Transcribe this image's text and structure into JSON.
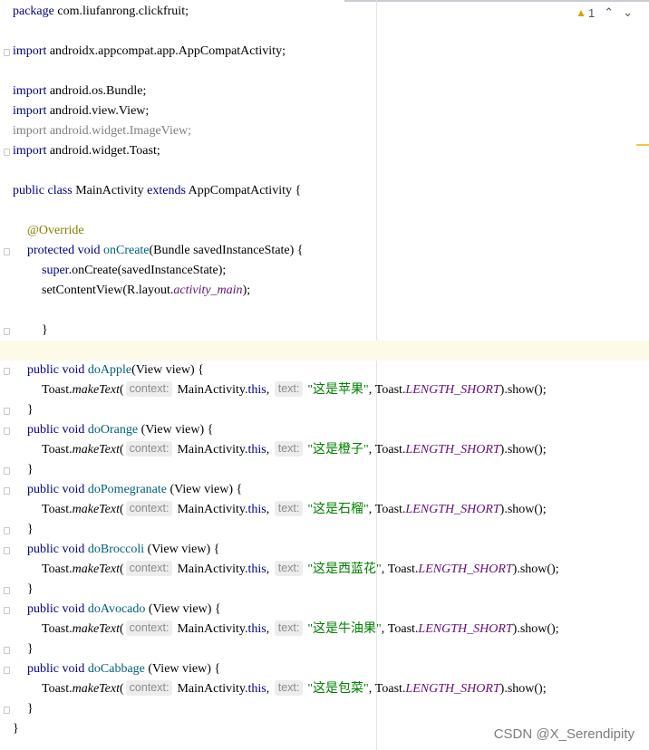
{
  "status": {
    "warning_icon": "warning-triangle-icon",
    "warning_count": "1",
    "up_arrow": "⌃",
    "down_arrow": "⌄"
  },
  "code": {
    "l1": {
      "kw": "package",
      "rest": " com.liufanrong.clickfruit;"
    },
    "l3": {
      "kw": "import",
      "rest": " androidx.appcompat.app.AppCompatActivity;"
    },
    "l5": {
      "kw": "import",
      "rest": " android.os.Bundle;"
    },
    "l6": {
      "kw": "import",
      "rest": " android.view.View;"
    },
    "l7": {
      "text": "import android.widget.ImageView;"
    },
    "l8": {
      "kw": "import",
      "rest": " android.widget.Toast;"
    },
    "l10": {
      "kw1": "public class",
      "name": " MainActivity ",
      "kw2": "extends",
      "rest": " AppCompatActivity {"
    },
    "l12": {
      "ann": "@Override"
    },
    "l13": {
      "kw": "protected void",
      "fn": " onCreate",
      "rest": "(Bundle savedInstanceState) {"
    },
    "l14": {
      "kw": "super",
      "rest": ".onCreate(savedInstanceState);"
    },
    "l15": {
      "pre": "setContentView(R.layout.",
      "ital": "activity_main",
      "post": ");"
    },
    "l17": {
      "text": "}"
    },
    "methods": [
      {
        "sig_kw": "public void",
        "name": " doApple",
        "params": "(View view) {",
        "string": "\"这是苹果\""
      },
      {
        "sig_kw": "public void",
        "name": " doOrange",
        "params": " (View view) {",
        "string": "\"这是橙子\""
      },
      {
        "sig_kw": "public void",
        "name": " doPomegranate",
        "params": " (View view) {",
        "string": "\"这是石榴\""
      },
      {
        "sig_kw": "public void",
        "name": " doBroccoli",
        "params": " (View view) {",
        "string": "\"这是西蓝花\""
      },
      {
        "sig_kw": "public void",
        "name": " doAvocado",
        "params": " (View view) {",
        "string": "\"这是牛油果\""
      },
      {
        "sig_kw": "public void",
        "name": " doCabbage",
        "params": " (View view) {",
        "string": "\"这是包菜\""
      }
    ],
    "toast_pre": "Toast.",
    "toast_method": "makeText",
    "paren_open": "(",
    "hint_context": "context:",
    "ctx_val": "MainActivity.",
    "this_kw": "this",
    "comma": ",",
    "hint_text": "text:",
    "toast_const_pre": ", Toast.",
    "toast_const": "LENGTH_SHORT",
    "toast_post": ").show();",
    "close_brace": "}",
    "class_close": "}"
  },
  "watermark": "CSDN @X_Serendipity"
}
